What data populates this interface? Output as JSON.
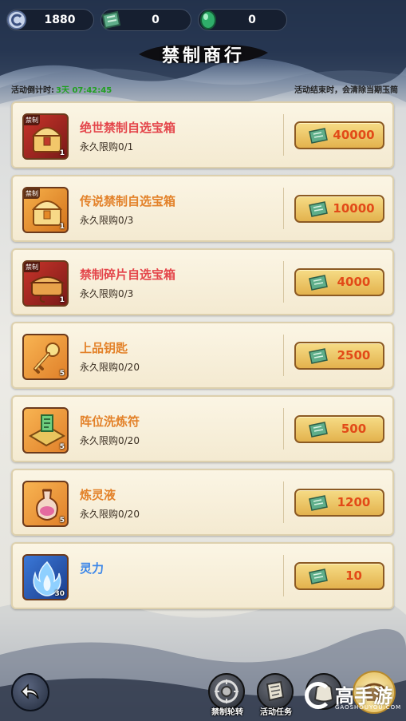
{
  "currency": {
    "coin": {
      "value": "1880",
      "icon": "silver-coin-icon"
    },
    "ticket": {
      "value": "0",
      "icon": "green-bill-icon"
    },
    "jade": {
      "value": "0",
      "icon": "jade-icon"
    }
  },
  "title": "禁制商行",
  "info": {
    "countdown_label": "活动倒计时:",
    "countdown_value": "3天 07:42:45",
    "notice": "活动结束时，会清除当期玉简"
  },
  "items": [
    {
      "name": "绝世禁制自选宝箱",
      "limit": "永久限购0/1",
      "price": "40000",
      "count": "1",
      "tag": "禁制",
      "name_color": "#e4464b",
      "icon": "red-treasure-chest-icon"
    },
    {
      "name": "传说禁制自选宝箱",
      "limit": "永久限购0/3",
      "price": "10000",
      "count": "1",
      "tag": "禁制",
      "name_color": "#e3822a",
      "icon": "gold-treasure-chest-icon"
    },
    {
      "name": "禁制碎片自选宝箱",
      "limit": "永久限购0/3",
      "price": "4000",
      "count": "1",
      "tag": "禁制",
      "name_color": "#e4464b",
      "icon": "fragment-chest-icon"
    },
    {
      "name": "上品钥匙",
      "limit": "永久限购0/20",
      "price": "2500",
      "count": "5",
      "tag": "",
      "name_color": "#e3822a",
      "icon": "golden-key-icon"
    },
    {
      "name": "阵位洗炼符",
      "limit": "永久限购0/20",
      "price": "500",
      "count": "5",
      "tag": "",
      "name_color": "#e3822a",
      "icon": "refine-talisman-icon"
    },
    {
      "name": "炼灵液",
      "limit": "永久限购0/20",
      "price": "1200",
      "count": "5",
      "tag": "",
      "name_color": "#e3822a",
      "icon": "spirit-potion-icon"
    },
    {
      "name": "灵力",
      "limit": "",
      "price": "10",
      "count": "30",
      "tag": "",
      "name_color": "#3b86e8",
      "icon": "blue-flame-icon"
    }
  ],
  "bottom_nav": {
    "back_icon": "back-arrow-icon",
    "items": [
      {
        "label": "禁制轮转",
        "icon": "wheel-icon"
      },
      {
        "label": "活动任务",
        "icon": "scroll-icon"
      },
      {
        "label": "",
        "icon": "bag-icon"
      }
    ],
    "shop_icon": "shop-icon"
  },
  "watermark": {
    "main": "高手游",
    "sub": "GAOSHOUYOU.COM"
  },
  "colors": {
    "price_text": "#e24a18",
    "countdown": "#20a020",
    "card_bg": "#f6eed7"
  }
}
